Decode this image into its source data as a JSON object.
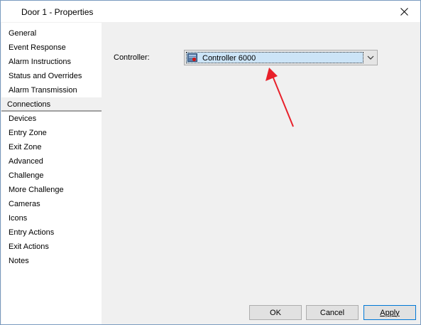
{
  "window": {
    "title": "Door 1 - Properties",
    "close_icon": "close-icon"
  },
  "sidebar": {
    "items": [
      {
        "label": "General",
        "selected": false
      },
      {
        "label": "Event Response",
        "selected": false
      },
      {
        "label": "Alarm Instructions",
        "selected": false
      },
      {
        "label": "Status and Overrides",
        "selected": false
      },
      {
        "label": "Alarm Transmission",
        "selected": false
      },
      {
        "label": "Connections",
        "selected": true
      },
      {
        "label": "Devices",
        "selected": false
      },
      {
        "label": "Entry Zone",
        "selected": false
      },
      {
        "label": "Exit Zone",
        "selected": false
      },
      {
        "label": "Advanced",
        "selected": false
      },
      {
        "label": "Challenge",
        "selected": false
      },
      {
        "label": "More Challenge",
        "selected": false
      },
      {
        "label": "Cameras",
        "selected": false
      },
      {
        "label": "Icons",
        "selected": false
      },
      {
        "label": "Entry Actions",
        "selected": false
      },
      {
        "label": "Exit Actions",
        "selected": false
      },
      {
        "label": "Notes",
        "selected": false
      }
    ]
  },
  "main": {
    "controller_label": "Controller:",
    "controller_value": "Controller 6000",
    "controller_icon": "controller-icon",
    "dropdown_icon": "chevron-down-icon",
    "annotation_color": "#e8202a"
  },
  "footer": {
    "ok_label": "OK",
    "cancel_label": "Cancel",
    "apply_label": "Apply"
  },
  "colors": {
    "accent": "#0078d7",
    "selection": "#cce4f7"
  }
}
